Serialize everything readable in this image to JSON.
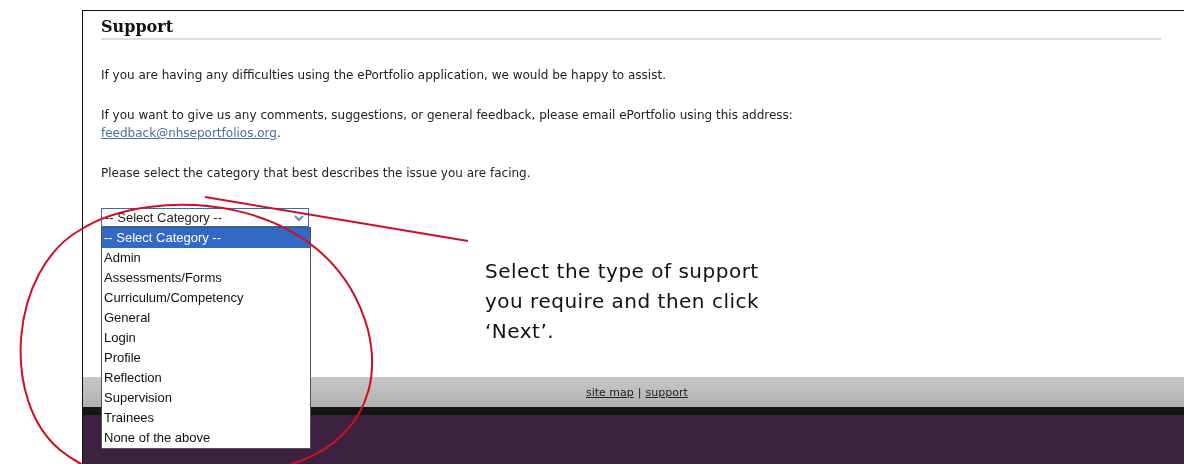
{
  "heading": "Support",
  "paragraphs": [
    {
      "text": "If you are having any difficulties using the ePortfolio application, we would be happy to assist."
    },
    {
      "text": "If you want to give us any comments, suggestions, or general feedback, please email ePortfolio using this address:",
      "link": "feedback@nhseportfolios.org",
      "after": "."
    },
    {
      "text": "Please select the category that best describes the issue you are facing."
    }
  ],
  "category_select": {
    "value": "-- Select Category --",
    "expanded": true,
    "options": [
      {
        "label": "-- Select Category --",
        "selected": true
      },
      {
        "label": "Admin",
        "selected": false
      },
      {
        "label": "Assessments/Forms",
        "selected": false
      },
      {
        "label": "Curriculum/Competency",
        "selected": false
      },
      {
        "label": "General",
        "selected": false
      },
      {
        "label": "Login",
        "selected": false
      },
      {
        "label": "Profile",
        "selected": false
      },
      {
        "label": "Reflection",
        "selected": false
      },
      {
        "label": "Supervision",
        "selected": false
      },
      {
        "label": "Trainees",
        "selected": false
      },
      {
        "label": "None of the above",
        "selected": false
      }
    ]
  },
  "footer": {
    "links": [
      "site map",
      "support"
    ],
    "separator": "|"
  },
  "annotation": {
    "text": "Select the type of support you require and then click ‘Next’."
  }
}
